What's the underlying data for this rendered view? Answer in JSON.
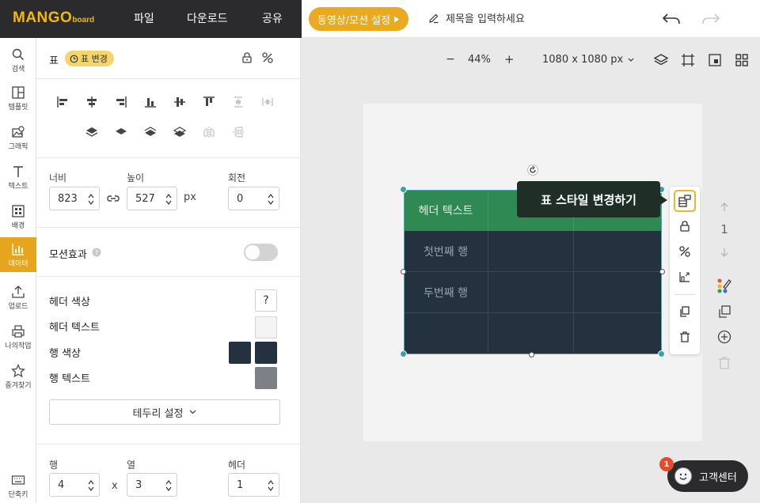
{
  "topbar": {
    "logo": "MANGO",
    "logo_sub": "board",
    "menus": [
      "파일",
      "다운로드",
      "공유"
    ],
    "motion_button": "동영상/모션 설정",
    "title_placeholder": "제목을 입력하세요"
  },
  "rail": [
    {
      "label": "검색",
      "icon": "search-icon"
    },
    {
      "label": "템플릿",
      "icon": "template-icon"
    },
    {
      "label": "그래픽",
      "icon": "graphic-icon"
    },
    {
      "label": "텍스트",
      "icon": "text-icon"
    },
    {
      "label": "배경",
      "icon": "background-icon"
    },
    {
      "label": "데이터",
      "icon": "chart-icon",
      "active": true
    },
    {
      "label": "업로드",
      "icon": "upload-icon"
    },
    {
      "label": "나의작업",
      "icon": "printer-icon"
    },
    {
      "label": "즐겨찾기",
      "icon": "star-icon"
    },
    {
      "label": "단축키",
      "icon": "keyboard-icon"
    }
  ],
  "panel": {
    "title": "표",
    "badge": "표 변경",
    "width_label": "너비",
    "width_value": "823",
    "height_label": "높이",
    "height_value": "527",
    "unit": "px",
    "rotation_label": "회전",
    "rotation_value": "0",
    "motion_label": "모션효과",
    "header_color_label": "헤더 색상",
    "header_text_label": "헤더 텍스트",
    "row_color_label": "행 색상",
    "row_text_label": "행 텍스트",
    "help_mark": "?",
    "border_button": "테두리 설정",
    "rows_label": "행",
    "rows_value": "4",
    "cols_label": "열",
    "cols_value": "3",
    "header_label": "헤더",
    "header_value": "1",
    "times": "x",
    "colors": {
      "header_text": "#f4f4f4",
      "row_color_1": "#243240",
      "row_color_2": "#243240",
      "row_text": "#7d8085"
    }
  },
  "toolbar": {
    "minus": "−",
    "zoom": "44%",
    "plus": "+",
    "canvas_size": "1080 x 1080 px"
  },
  "table": {
    "header": [
      "헤더 텍스트",
      "",
      ""
    ],
    "rows": [
      [
        "첫번째 행",
        "",
        ""
      ],
      [
        "두번째 행",
        "",
        ""
      ],
      [
        "",
        "",
        ""
      ]
    ]
  },
  "tooltip": "표 스타일 변경하기",
  "layer_page": "1",
  "support": {
    "label": "고객센터",
    "badge": "1"
  }
}
